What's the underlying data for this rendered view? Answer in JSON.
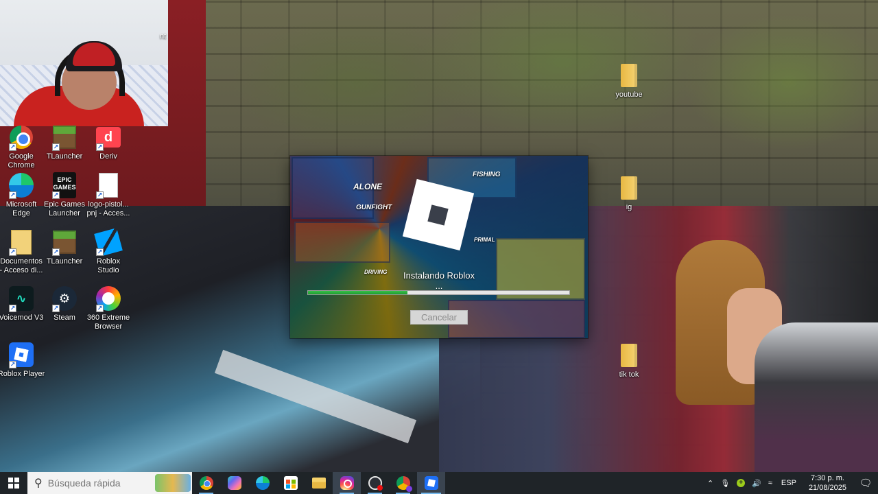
{
  "desktop": {
    "icons": [
      {
        "label": "Google\nChrome",
        "icon": "chrome-icon"
      },
      {
        "label": "TLauncher",
        "icon": "minecraft-icon"
      },
      {
        "label": "Deriv",
        "icon": "deriv-icon"
      },
      {
        "label": "Microsoft\nEdge",
        "icon": "edge-icon"
      },
      {
        "label": "Epic Games\nLauncher",
        "icon": "epic-games-icon"
      },
      {
        "label": "logo-pistol...\npnj - Acces...",
        "icon": "file-icon"
      },
      {
        "label": "Documentos\n- Acceso di...",
        "icon": "documents-icon"
      },
      {
        "label": "TLauncher",
        "icon": "minecraft-icon"
      },
      {
        "label": "Roblox\nStudio",
        "icon": "roblox-studio-icon"
      },
      {
        "label": "Voicemod V3",
        "icon": "voicemod-icon"
      },
      {
        "label": "Steam",
        "icon": "steam-icon"
      },
      {
        "label": "360 Extreme\nBrowser",
        "icon": "360-browser-icon"
      },
      {
        "label": "Roblox Player",
        "icon": "roblox-icon"
      },
      {
        "label": "youtube",
        "icon": "folder-icon"
      },
      {
        "label": "ig",
        "icon": "folder-icon"
      },
      {
        "label": "tik tok",
        "icon": "folder-icon"
      }
    ],
    "webcam_fragment_text": "nt"
  },
  "installer": {
    "tile_labels": [
      "ALONE",
      "GUNFIGHT",
      "FISHING",
      "DRIVING",
      "PRIMAL"
    ],
    "epic_text": "EPIC\nGAMES",
    "status": "Instalando Roblox ...",
    "progress_percent": 38,
    "cancel_label": "Cancelar",
    "colors": {
      "progress": "#2bb13c",
      "accent_logo": "#ffffff"
    }
  },
  "taskbar": {
    "search_placeholder": "Búsqueda rápida",
    "apps": [
      "chrome-icon",
      "copilot-icon",
      "edge-icon",
      "microsoft-store-icon",
      "file-explorer-icon",
      "instagram-icon",
      "speedometer-icon",
      "chrome-profile-icon",
      "roblox-icon"
    ],
    "tray": {
      "language": "ESP",
      "time": "7:30 p. m.",
      "date": "21/08/2025"
    }
  }
}
